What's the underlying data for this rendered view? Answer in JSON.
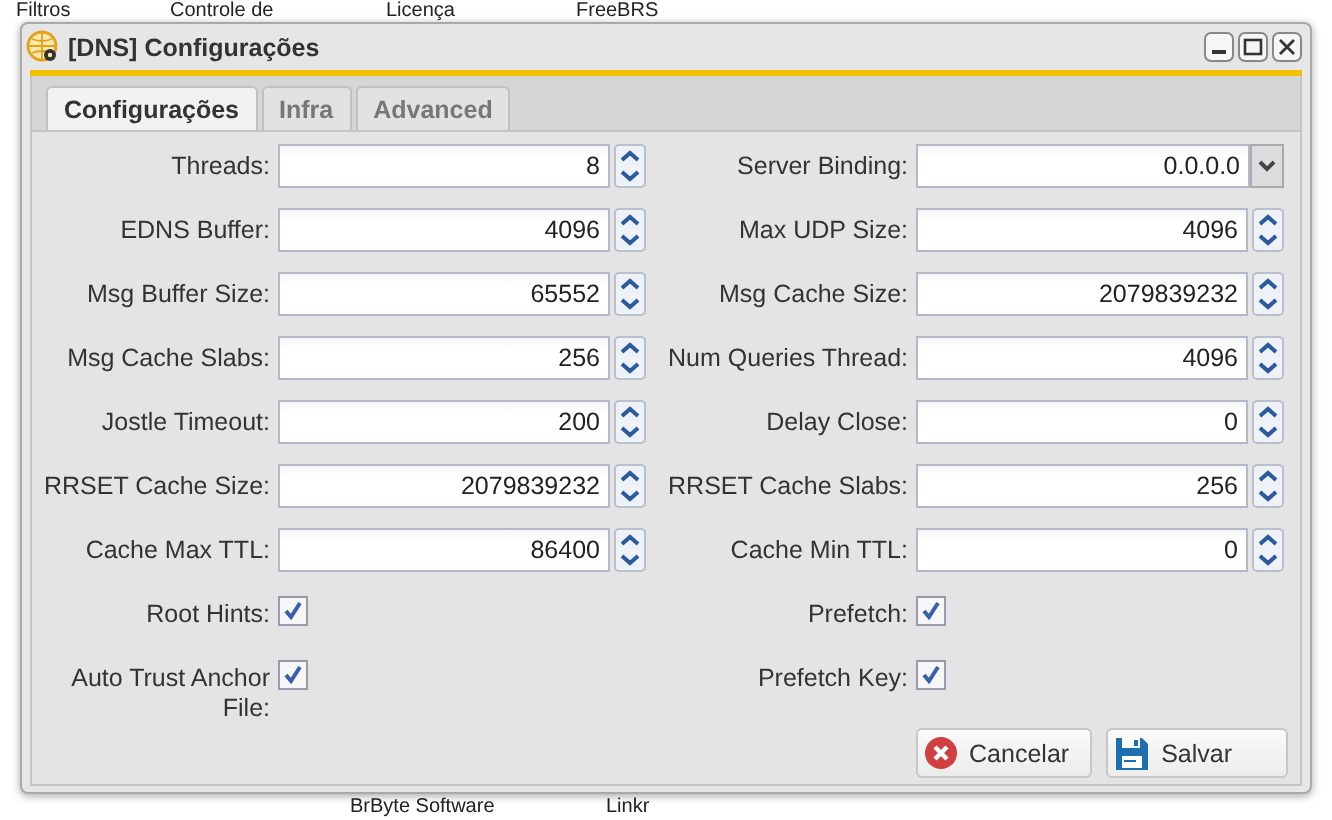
{
  "desktop": {
    "labels": [
      {
        "text": "Filtros"
      },
      {
        "text": "Controle de"
      },
      {
        "text": "Licença"
      },
      {
        "text": "FreeBRS"
      },
      {
        "text": "BrByte Software"
      },
      {
        "text": "Linkr"
      }
    ]
  },
  "window": {
    "title": "[DNS] Configurações"
  },
  "tabs": [
    {
      "label": "Configurações",
      "selected": true
    },
    {
      "label": "Infra",
      "selected": false
    },
    {
      "label": "Advanced",
      "selected": false
    }
  ],
  "fields": [
    {
      "kind": "spinner",
      "label": "Threads:",
      "value": "8"
    },
    {
      "kind": "combo",
      "label": "Server Binding:",
      "value": "0.0.0.0"
    },
    {
      "kind": "spinner",
      "label": "EDNS Buffer:",
      "value": "4096"
    },
    {
      "kind": "spinner",
      "label": "Max UDP Size:",
      "value": "4096"
    },
    {
      "kind": "spinner",
      "label": "Msg Buffer Size:",
      "value": "65552"
    },
    {
      "kind": "spinner",
      "label": "Msg Cache Size:",
      "value": "2079839232"
    },
    {
      "kind": "spinner",
      "label": "Msg Cache Slabs:",
      "value": "256"
    },
    {
      "kind": "spinner",
      "label": "Num Queries Thread:",
      "value": "4096"
    },
    {
      "kind": "spinner",
      "label": "Jostle Timeout:",
      "value": "200"
    },
    {
      "kind": "spinner",
      "label": "Delay Close:",
      "value": "0"
    },
    {
      "kind": "spinner",
      "label": "RRSET Cache Size:",
      "value": "2079839232"
    },
    {
      "kind": "spinner",
      "label": "RRSET Cache Slabs:",
      "value": "256"
    },
    {
      "kind": "spinner",
      "label": "Cache Max TTL:",
      "value": "86400"
    },
    {
      "kind": "spinner",
      "label": "Cache Min TTL:",
      "value": "0"
    },
    {
      "kind": "checkbox",
      "label": "Root Hints:",
      "checked": true
    },
    {
      "kind": "checkbox",
      "label": "Prefetch:",
      "checked": true
    },
    {
      "kind": "checkbox",
      "label": "Auto Trust Anchor File:",
      "checked": true
    },
    {
      "kind": "checkbox",
      "label": "Prefetch Key:",
      "checked": true
    }
  ],
  "buttons": [
    {
      "kind": "cancel",
      "label": "Cancelar"
    },
    {
      "kind": "save",
      "label": "Salvar"
    }
  ]
}
